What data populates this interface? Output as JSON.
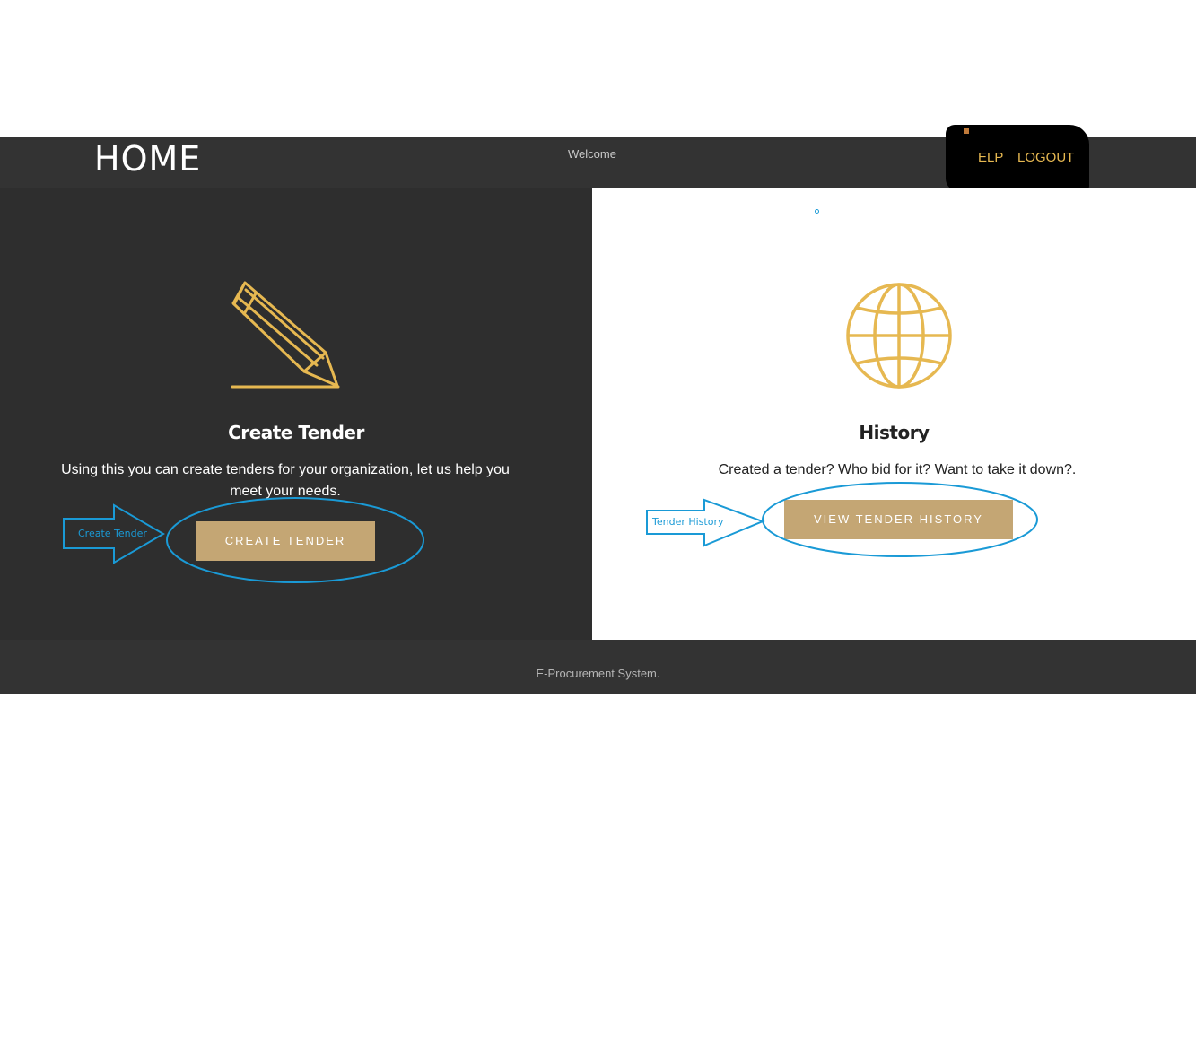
{
  "header": {
    "brand": "HOME",
    "welcome": "Welcome",
    "links": {
      "elp": "ELP",
      "logout": "LOGOUT"
    }
  },
  "create_panel": {
    "icon": "pencil-icon",
    "title": "Create Tender",
    "description": "Using this you can create tenders for your organization, let us help you meet your needs.",
    "button_label": "CREATE TENDER"
  },
  "history_panel": {
    "icon": "globe-icon",
    "title": "History",
    "description": "Created a tender? Who bid for it? Want to take it down?.",
    "button_label": "VIEW TENDER HISTORY"
  },
  "footer": {
    "text": "E-Procurement System."
  },
  "annotations": {
    "create_label": "Create Tender",
    "history_label": "Tender History"
  },
  "colors": {
    "nav_bg": "#333333",
    "dark_panel": "#2e2e2e",
    "accent_gold": "#e6b851",
    "button_tan": "#c4a674",
    "annotation_blue": "#1a9ad6"
  }
}
